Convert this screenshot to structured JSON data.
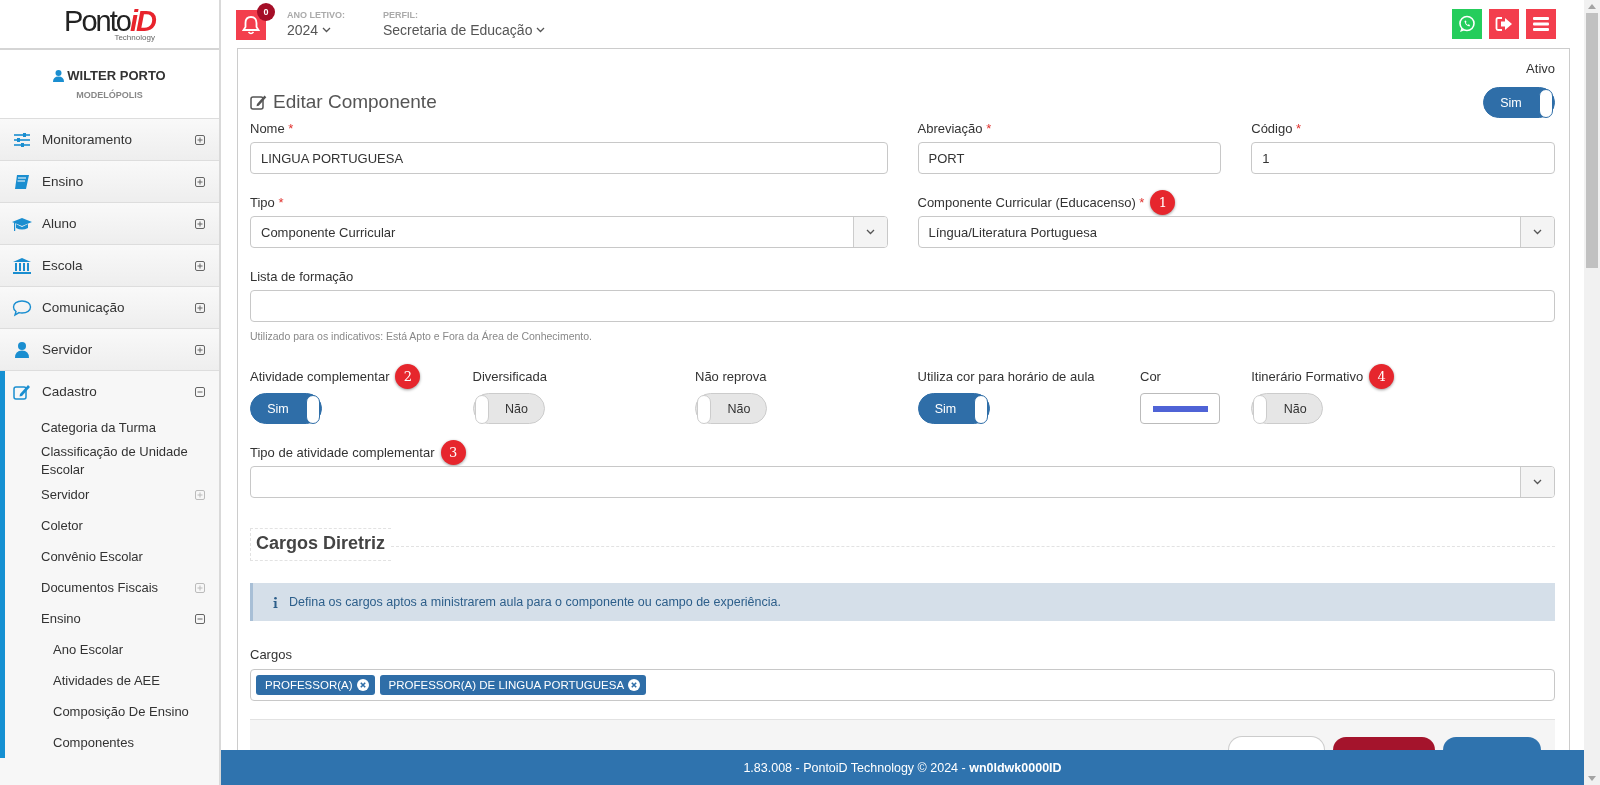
{
  "header": {
    "logo": {
      "brand": "Ponto",
      "accent": "iD",
      "tagline": "Technology"
    },
    "notifications": {
      "count": "0"
    },
    "year": {
      "label": "ANO LETIVO:",
      "value": "2024"
    },
    "profile": {
      "label": "PERFIL:",
      "value": "Secretaria de Educação"
    }
  },
  "sidebar": {
    "user": {
      "name": "WILTER PORTO",
      "city": "MODELÓPOLIS"
    },
    "items": [
      {
        "label": "Monitoramento",
        "expanded": false
      },
      {
        "label": "Ensino",
        "expanded": false
      },
      {
        "label": "Aluno",
        "expanded": false
      },
      {
        "label": "Escola",
        "expanded": false
      },
      {
        "label": "Comunicação",
        "expanded": false
      },
      {
        "label": "Servidor",
        "expanded": false
      },
      {
        "label": "Cadastro",
        "expanded": true,
        "children": [
          {
            "label": "Categoria da Turma"
          },
          {
            "label": "Classificação de Unidade Escolar"
          },
          {
            "label": "Servidor",
            "expanded": false
          },
          {
            "label": "Coletor"
          },
          {
            "label": "Convênio Escolar"
          },
          {
            "label": "Documentos Fiscais",
            "expanded": false
          },
          {
            "label": "Ensino",
            "expanded": true,
            "children": [
              {
                "label": "Ano Escolar"
              },
              {
                "label": "Atividades de AEE"
              },
              {
                "label": "Composição De Ensino"
              },
              {
                "label": "Componentes"
              }
            ]
          }
        ]
      }
    ]
  },
  "form": {
    "title": "Editar Componente",
    "active": {
      "label": "Ativo",
      "on": true,
      "text": "Sim"
    },
    "fields": [
      {
        "kind": "text",
        "label": "Nome",
        "required_mark": "*",
        "value": "LINGUA PORTUGUESA"
      },
      {
        "kind": "text",
        "label": "Abreviação",
        "required_mark": "*",
        "value": "PORT"
      },
      {
        "kind": "text",
        "label": "Código",
        "required_mark": "*",
        "value": "1"
      },
      {
        "kind": "select",
        "label": "Tipo",
        "required_mark": "*",
        "value": "Componente Curricular"
      },
      {
        "kind": "select",
        "label": "Componente Curricular (Educacenso)",
        "required_mark": "*",
        "value": "Língua/Literatura Portuguesa",
        "badge": "1"
      },
      {
        "kind": "text",
        "label": "Lista de formação",
        "hint": "Utilizado para os indicativos: Está Apto e Fora da Área de Conhecimento."
      },
      {
        "kind": "toggle",
        "label": "Atividade complementar",
        "on": true,
        "text": "Sim",
        "badge": "2"
      },
      {
        "kind": "toggle",
        "label": "Diversificada",
        "on": false,
        "text": "Não"
      },
      {
        "kind": "toggle",
        "label": "Não reprova",
        "on": false,
        "text": "Não"
      },
      {
        "kind": "toggle",
        "label": "Utiliza cor para horário de aula",
        "on": true,
        "text": "Sim"
      },
      {
        "kind": "color",
        "label": "Cor",
        "color": "#4f63d6"
      },
      {
        "kind": "toggle",
        "label": "Itinerário Formativo",
        "on": false,
        "text": "Não",
        "badge": "4"
      },
      {
        "kind": "select",
        "label": "Tipo de atividade complementar",
        "badge": "3"
      }
    ],
    "section": {
      "title": "Cargos Diretriz",
      "info": "Defina os cargos aptos a ministrarem aula para o componente ou campo de experiência.",
      "cargos": {
        "label": "Cargos",
        "tags": [
          "PROFESSOR(A)",
          "PROFESSOR(A) DE LINGUA PORTUGUESA"
        ]
      }
    }
  },
  "footer": {
    "text": "1.83.008 - PontoiD Technology © 2024 - **wn0ldwk0000ID**"
  }
}
